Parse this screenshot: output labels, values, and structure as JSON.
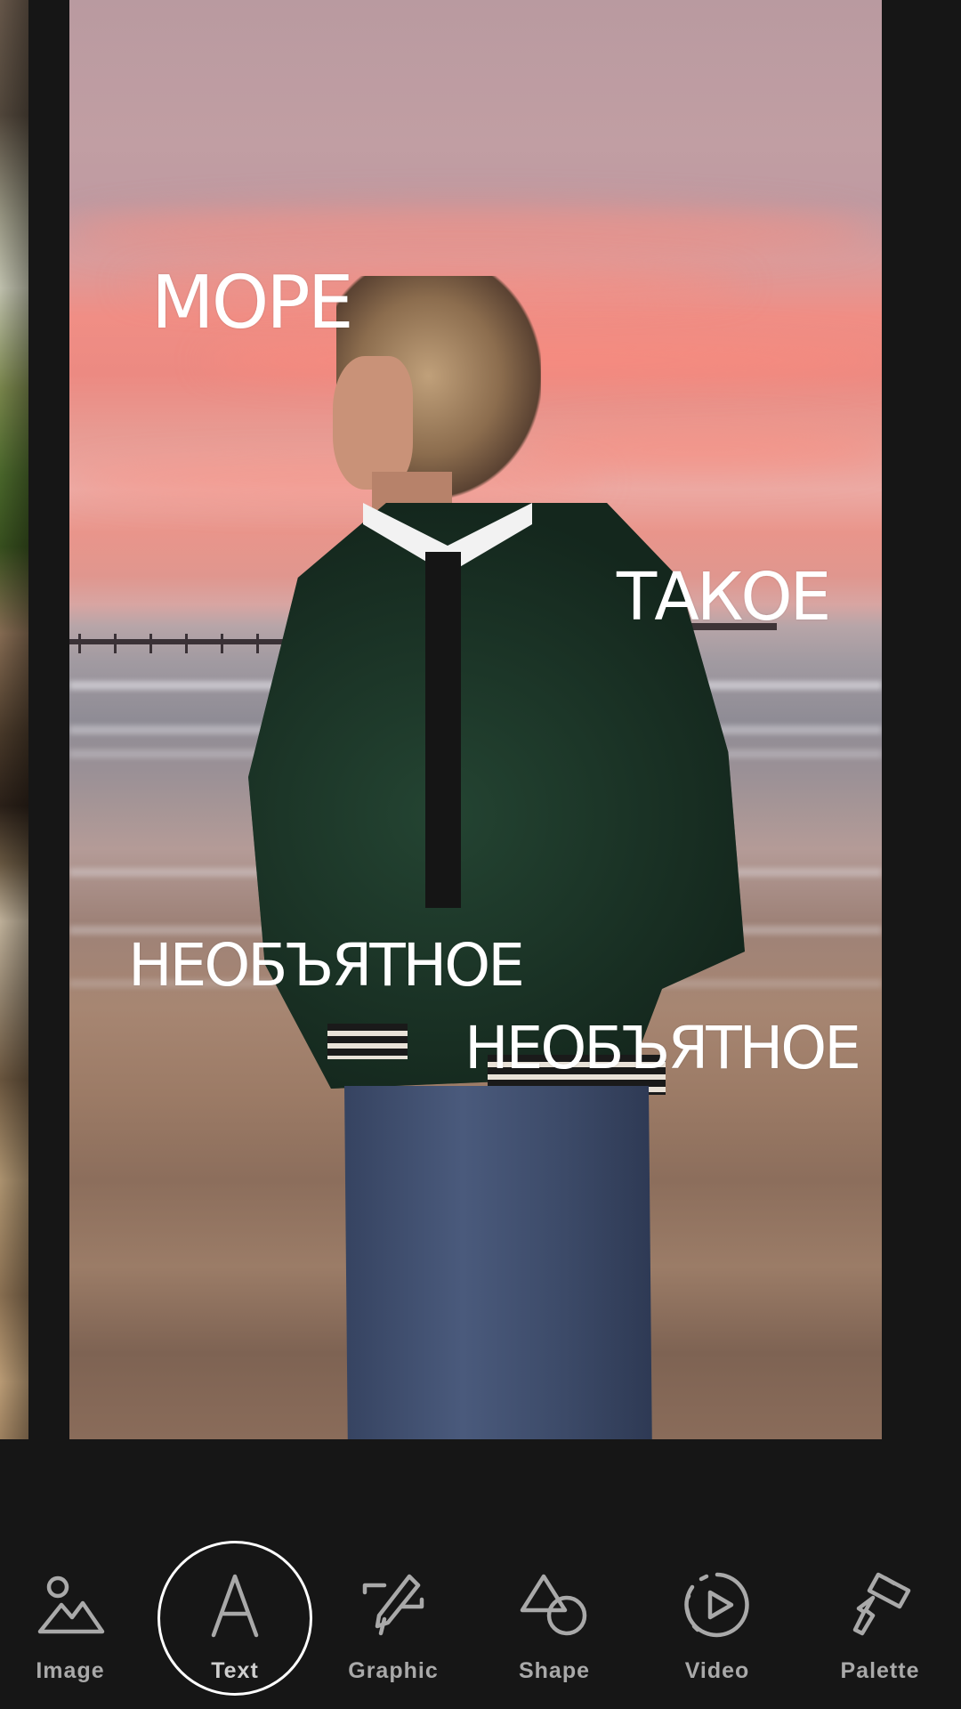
{
  "story_texts": [
    {
      "text": "МОРЕ"
    },
    {
      "text": "ТАКОЕ"
    },
    {
      "text": "НЕОБЪЯТНОЕ"
    },
    {
      "text": "НЕОБЪЯТНОЕ"
    }
  ],
  "toolbar": {
    "active": "text",
    "tools": [
      {
        "id": "image",
        "label": "Image",
        "icon": "image-icon"
      },
      {
        "id": "text",
        "label": "Text",
        "icon": "text-icon"
      },
      {
        "id": "graphic",
        "label": "Graphic",
        "icon": "graphic-icon"
      },
      {
        "id": "shape",
        "label": "Shape",
        "icon": "shape-icon"
      },
      {
        "id": "video",
        "label": "Video",
        "icon": "video-icon"
      },
      {
        "id": "palette",
        "label": "Palette",
        "icon": "palette-icon"
      }
    ]
  },
  "colors": {
    "background": "#161616",
    "label": "#a9a9a9",
    "text_overlay": "#ffffff",
    "active_ring": "#ffffff"
  }
}
